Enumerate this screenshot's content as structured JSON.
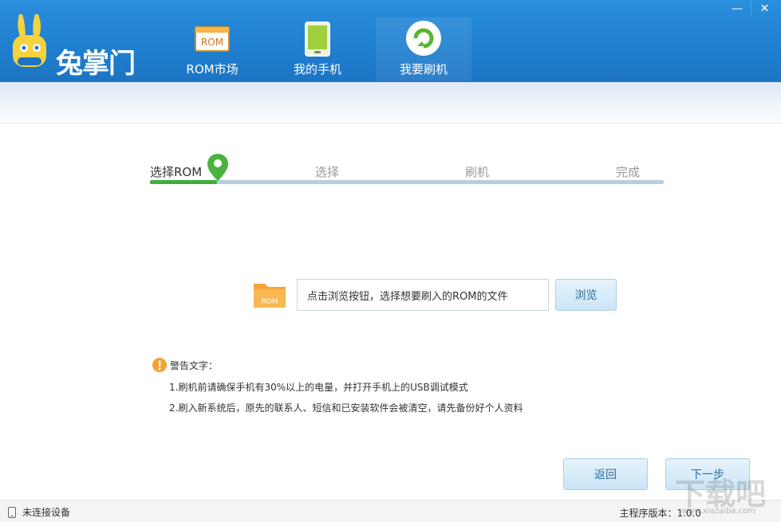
{
  "header": {
    "brand": "兔掌门",
    "nav": [
      {
        "label": "ROM市场",
        "icon": "rom-market-icon"
      },
      {
        "label": "我的手机",
        "icon": "phone-icon"
      },
      {
        "label": "我要刷机",
        "icon": "refresh-flash-icon"
      }
    ],
    "window_controls": {
      "minimize": "—",
      "close": "✕"
    }
  },
  "steps": {
    "items": [
      "选择ROM",
      "选择",
      "刷机",
      "完成"
    ],
    "current": 0,
    "progress_fraction": 0.13
  },
  "file_picker": {
    "folder_label": "ROM",
    "placeholder": "点击浏览按钮，选择想要刷入的ROM的文件",
    "browse_label": "浏览"
  },
  "warning": {
    "title": "警告文字：",
    "lines": [
      "1.刷机前请确保手机有30%以上的电量，并打开手机上的USB调试模式",
      "2.刷入新系统后，原先的联系人、短信和已安装软件会被清空，请先备份好个人资料"
    ]
  },
  "buttons": {
    "back": "返回",
    "next": "下一步"
  },
  "statusbar": {
    "device_status": "未连接设备",
    "version": "主程序版本：1.0.0"
  },
  "watermark": {
    "text": "下载吧",
    "url": "www.xiazaiba.com"
  },
  "colors": {
    "header_blue": "#1f7fcf",
    "progress_green": "#3fae3b",
    "track_blue": "#b6cde2"
  }
}
